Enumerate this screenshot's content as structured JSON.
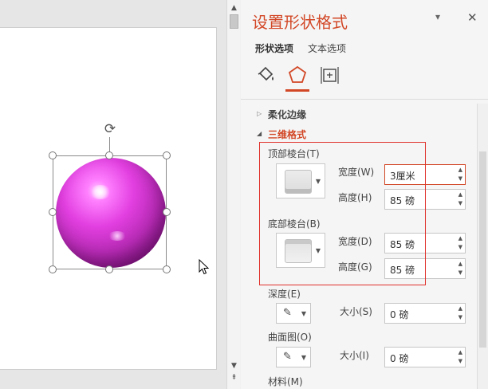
{
  "pane": {
    "title": "设置形状格式",
    "dropdown_icon": "▾",
    "close_icon": "✕",
    "tabs": [
      "形状选项",
      "文本选项"
    ],
    "icons": [
      "fill-bucket-icon",
      "pentagon-effects-icon",
      "size-layout-icon"
    ]
  },
  "sections": {
    "soft_edges": "柔化边缘",
    "format3d": "三维格式"
  },
  "bevel": {
    "top_label": "顶部棱台(T)",
    "width_label": "宽度(W)",
    "height_label": "高度(H)",
    "top_width": "3厘米",
    "top_height": "85 磅",
    "bottom_label": "底部棱台(B)",
    "bottom_width_label": "宽度(D)",
    "bottom_height_label": "高度(G)",
    "bottom_width": "85 磅",
    "bottom_height": "85 磅"
  },
  "depth": {
    "label": "深度(E)",
    "size_label": "大小(S)",
    "size": "0 磅"
  },
  "contour": {
    "label": "曲面图(O)",
    "size_label": "大小(I)",
    "size": "0 磅"
  },
  "material": {
    "label": "材料(M)"
  },
  "colors": {
    "accent": "#d24726",
    "highlight_box": "#e0302a",
    "sphere": "#c930c7"
  }
}
